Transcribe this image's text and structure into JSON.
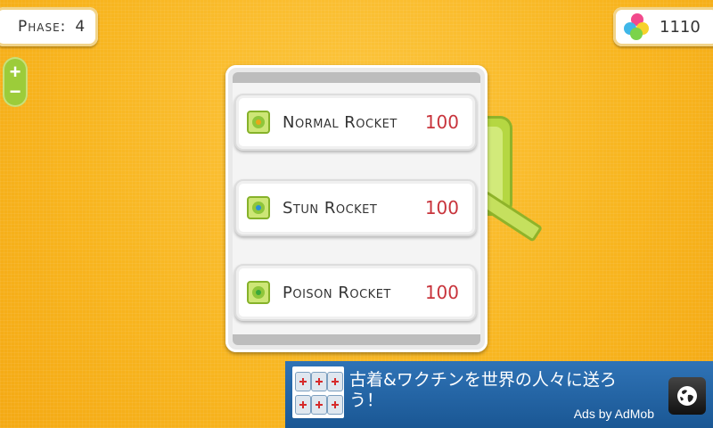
{
  "hud": {
    "phase_label": "Phase:",
    "phase_value": "4",
    "coins_value": "1110",
    "coins_icon": "colored-gems-icon"
  },
  "zoom": {
    "plus": "+",
    "minus": "−"
  },
  "menu": {
    "items": [
      {
        "label": "Normal Rocket",
        "price": "100",
        "icon": "rocket-icon",
        "dot_color": "#e8a818"
      },
      {
        "label": "Stun Rocket",
        "price": "100",
        "icon": "rocket-icon",
        "dot_color": "#2a8fd8"
      },
      {
        "label": "Poison Rocket",
        "price": "100",
        "icon": "rocket-icon",
        "dot_color": "#3aa83a"
      }
    ]
  },
  "ad": {
    "text": "古着&ワクチンを世界の人々に送ろう！",
    "by": "Ads by AdMob",
    "button_icon": "globe-icon"
  },
  "colors": {
    "background": "#f9b823",
    "price": "#c8343c",
    "turret": "#b5d742",
    "ad_bg": "#1f62a5"
  }
}
